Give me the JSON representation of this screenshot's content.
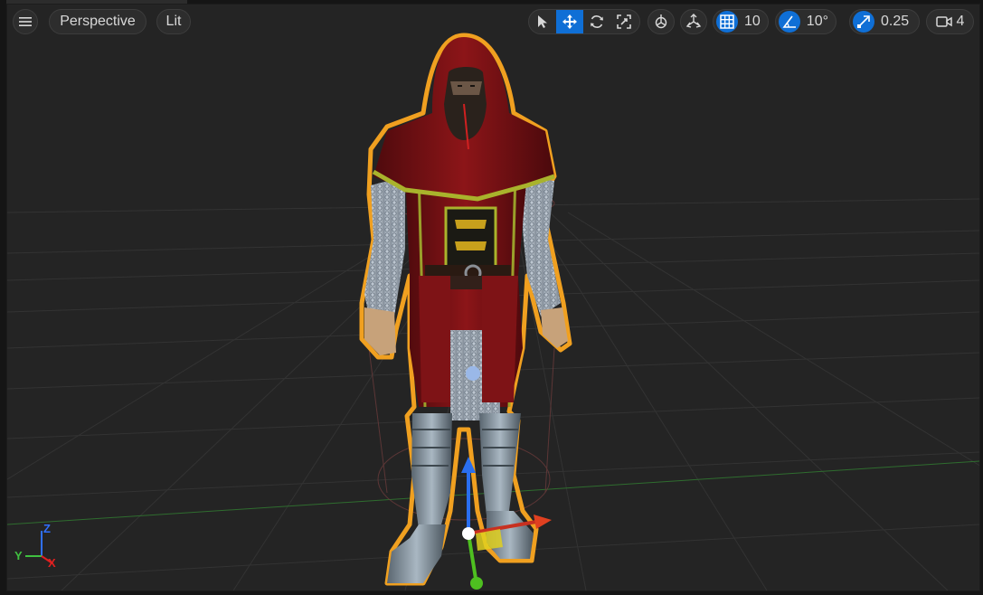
{
  "toolbar": {
    "menu_icon": "hamburger-icon",
    "view_mode": "Perspective",
    "lighting_mode": "Lit",
    "transform_tools": [
      "select-arrow-icon",
      "move-icon",
      "rotate-icon",
      "scale-icon"
    ],
    "active_transform_tool": "move",
    "surface_snap_icon": "surface-snap-icon",
    "world_local_icon": "world-local-icon",
    "grid_snap_value": "10",
    "rotation_snap_value": "10°",
    "scale_snap_value": "0.25",
    "camera_speed_value": "4"
  },
  "axes_indicator": {
    "x": "X",
    "y": "Y",
    "z": "Z",
    "x_color": "#e02020",
    "y_color": "#40c040",
    "z_color": "#3070ff"
  },
  "colors": {
    "accent": "#0f6fd6",
    "selection_outline": "#f0a020",
    "viewport_bg": "#242424"
  }
}
